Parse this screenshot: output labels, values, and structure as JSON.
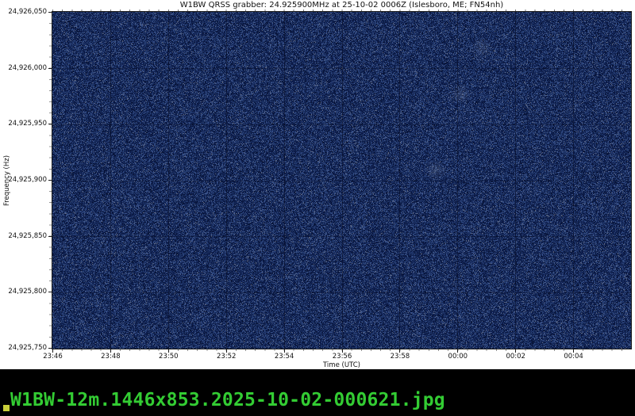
{
  "chart_data": {
    "type": "heatmap",
    "title": "W1BW QRSS grabber: 24.925900MHz at 25-10-02 0006Z (Islesboro, ME; FN54nh)",
    "xlabel": "Time (UTC)",
    "ylabel": "Frequency (Hz)",
    "x_tick_labels": [
      "23:46",
      "23:48",
      "23:50",
      "23:52",
      "23:54",
      "23:56",
      "23:58",
      "00:00",
      "00:02",
      "00:04"
    ],
    "y_tick_labels": [
      "24,926,050",
      "24,926,000",
      "24,925,950",
      "24,925,900",
      "24,925,850",
      "24,925,800",
      "24,925,750"
    ],
    "x_range": [
      "23:46",
      "00:06"
    ],
    "x_tick_step_minutes": 2,
    "y_range_hz": [
      24925750,
      24926050
    ],
    "y_tick_step_hz": 50,
    "legend": false,
    "content_description": "Dark navy broadband noise spectrogram with no visible QRSS signal traces; faint dark gridlines at each 2-minute and 50 Hz tick; a few very faint light smudges in the noise",
    "noise_palette": [
      {
        "color": "#0c1b49",
        "weight": 24
      },
      {
        "color": "#081437",
        "weight": 12
      },
      {
        "color": "#142757",
        "weight": 24
      },
      {
        "color": "#1e3468",
        "weight": 17
      },
      {
        "color": "#2a4379",
        "weight": 12
      },
      {
        "color": "#38518b",
        "weight": 8
      },
      {
        "color": "#4a5c85",
        "weight": 5
      },
      {
        "color": "#5d6680",
        "weight": 2
      }
    ],
    "gridline_color_v": "rgba(2,6,28,0.45)",
    "gridline_color_h": "rgba(2,6,28,0.28)",
    "artifacts": [
      {
        "x": 0.705,
        "y": 0.245
      },
      {
        "x": 0.663,
        "y": 0.47
      },
      {
        "x": 0.742,
        "y": 0.105
      }
    ]
  },
  "status_bar": {
    "filename": "W1BW-12m.1446x853.2025-10-02-000621.jpg",
    "background": "#000000",
    "text_color": "#33cc33",
    "cursor_color": "#c9cf3a"
  }
}
